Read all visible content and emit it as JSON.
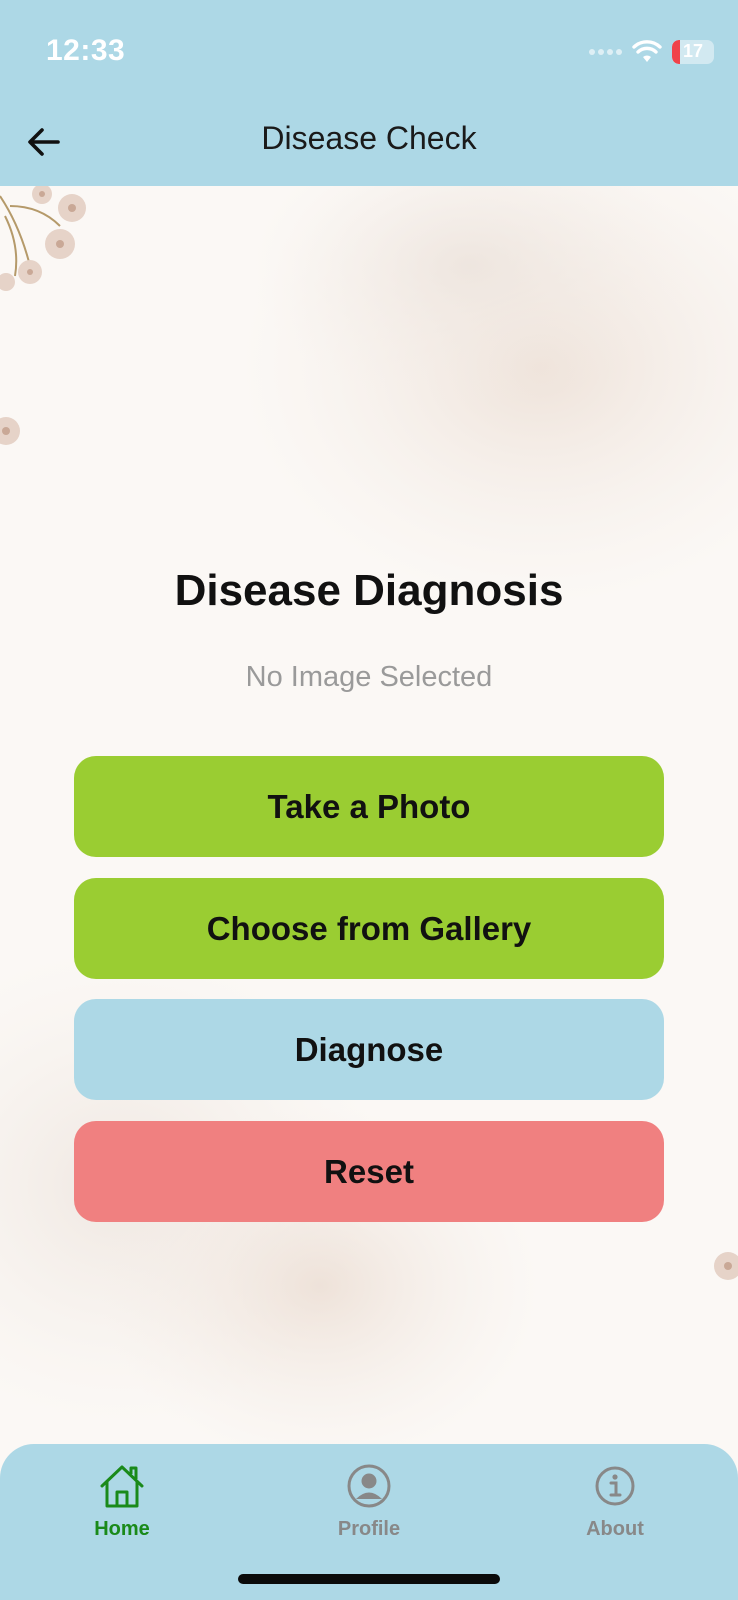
{
  "status_bar": {
    "time": "12:33",
    "battery_level": "17"
  },
  "app_bar": {
    "title": "Disease Check",
    "back_icon": "arrow-left-icon"
  },
  "main": {
    "title": "Disease Diagnosis",
    "image_status": "No Image Selected",
    "buttons": [
      {
        "label": "Take a Photo",
        "color": "#9acd32"
      },
      {
        "label": "Choose from Gallery",
        "color": "#9acd32"
      },
      {
        "label": "Diagnose",
        "color": "#add8e6"
      },
      {
        "label": "Reset",
        "color": "#f08080"
      }
    ]
  },
  "tab_bar": {
    "items": [
      {
        "label": "Home",
        "icon": "home-icon",
        "active": true
      },
      {
        "label": "Profile",
        "icon": "profile-icon",
        "active": false
      },
      {
        "label": "About",
        "icon": "info-icon",
        "active": false
      }
    ],
    "active_color": "#1a8a1a",
    "inactive_color": "#888888"
  },
  "colors": {
    "app_bar": "#add8e6",
    "background": "#fbf8f5"
  }
}
